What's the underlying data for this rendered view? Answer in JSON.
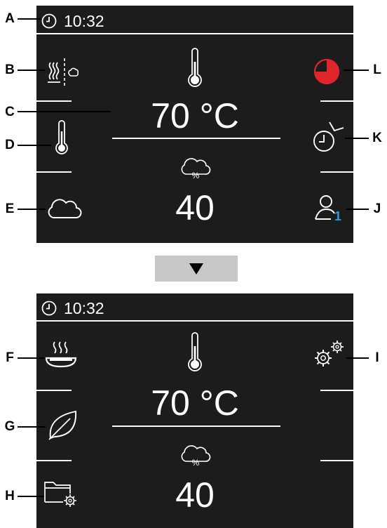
{
  "callouts": {
    "A": "A",
    "B": "B",
    "C": "C",
    "D": "D",
    "E": "E",
    "J": "J",
    "K": "K",
    "L": "L",
    "F": "F",
    "G": "G",
    "H": "H",
    "I": "I"
  },
  "top_panel": {
    "time": "10:32",
    "temperature": "70 °C",
    "humidity_value": "40",
    "humidity_symbol": "%",
    "user_profile_number": "1",
    "timer_fill_fraction": 0.75
  },
  "bottom_panel": {
    "time": "10:32",
    "temperature": "70 °C",
    "humidity_value": "40",
    "humidity_symbol": "%"
  },
  "icons": {
    "clock": "clock-icon",
    "heat_steam_split": "heat-steam-icon",
    "thermometer": "thermometer-icon",
    "cloud": "cloud-icon",
    "humidity_cloud": "humidity-cloud-icon",
    "timer_pie": "timer-pie-icon",
    "start_time": "start-time-clock-icon",
    "user_profile": "user-profile-icon",
    "cooking_dish": "cooking-dish-icon",
    "leaf": "leaf-icon",
    "folder_settings": "folder-settings-icon",
    "settings_gears": "settings-gears-icon",
    "down_arrow": "down-arrow-icon"
  },
  "colors": {
    "panel_background": "#1c1c1c",
    "timer_red": "#e0262b",
    "profile_blue": "#2a9de0",
    "arrow_button": "#c8c8c8"
  }
}
